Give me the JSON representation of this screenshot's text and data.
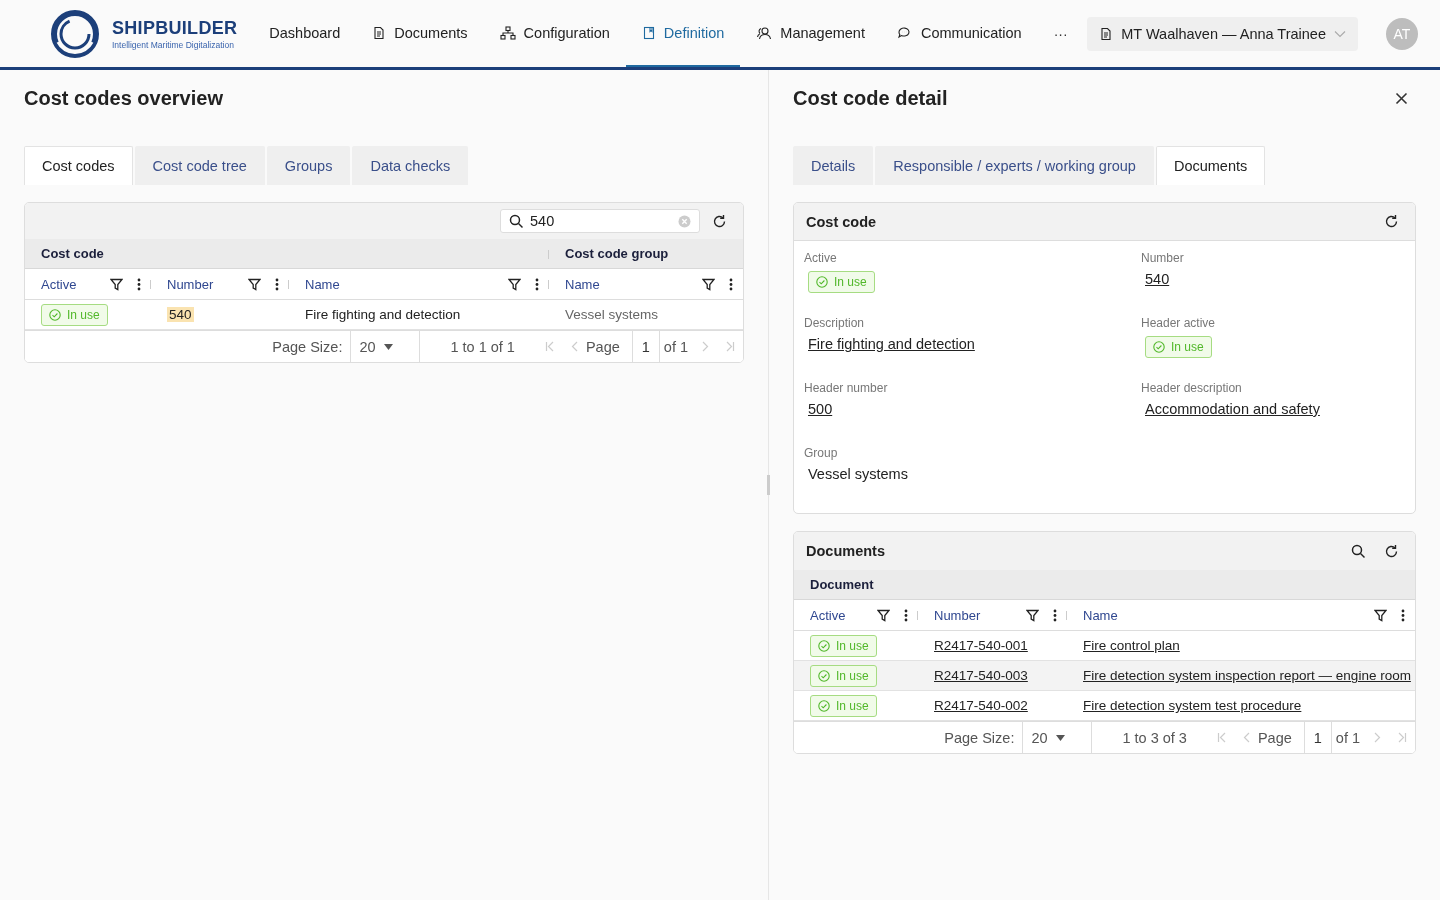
{
  "header": {
    "logo": {
      "name": "SHIPBUILDER",
      "tagline": "Intelligent Maritime Digitalization"
    },
    "nav": [
      {
        "label": "Dashboard",
        "selected": false
      },
      {
        "label": "Documents",
        "selected": false
      },
      {
        "label": "Configuration",
        "selected": false
      },
      {
        "label": "Definition",
        "selected": true
      },
      {
        "label": "Management",
        "selected": false
      },
      {
        "label": "Communication",
        "selected": false
      }
    ],
    "more": "···",
    "context": "MT Waalhaven — Anna Trainee",
    "avatar": "AT"
  },
  "overview": {
    "title": "Cost codes overview",
    "tabs": [
      {
        "label": "Cost codes",
        "selected": true
      },
      {
        "label": "Cost code tree",
        "selected": false
      },
      {
        "label": "Groups",
        "selected": false
      },
      {
        "label": "Data checks",
        "selected": false
      }
    ],
    "grid": {
      "search": "540",
      "column_groups": [
        {
          "label": "Cost code",
          "columns": [
            "Active",
            "Number",
            "Name"
          ]
        },
        {
          "label": "Cost code group",
          "columns": [
            "Name"
          ]
        }
      ],
      "rows": [
        {
          "selected": false,
          "cells": [
            {
              "kind": "status",
              "text": "In use",
              "active": true
            },
            {
              "kind": "text",
              "text": "540",
              "match": true
            },
            {
              "kind": "text",
              "text": "Fire fighting and detection",
              "match": false
            },
            {
              "kind": "muted",
              "text": "Vessel systems"
            }
          ]
        }
      ],
      "pagination": {
        "page_size_label": "Page Size:",
        "page_size": "20",
        "range": "1 to 1 of 1",
        "page_label": "Page",
        "page": "1",
        "of": "of 1"
      }
    }
  },
  "detail": {
    "title": "Cost code detail",
    "tabs": [
      {
        "label": "Details",
        "selected": false
      },
      {
        "label": "Responsible / experts / working group",
        "selected": false
      },
      {
        "label": "Documents",
        "selected": true
      }
    ],
    "card": {
      "title": "Cost code",
      "fields": [
        {
          "label": "Active",
          "kind": "status",
          "value": "In use",
          "active": true
        },
        {
          "label": "Number",
          "kind": "link",
          "value": "540"
        },
        {
          "label": "Description",
          "kind": "link",
          "value": "Fire fighting and detection"
        },
        {
          "label": "Header active",
          "kind": "status",
          "value": "In use",
          "active": true
        },
        {
          "label": "Header number",
          "kind": "link",
          "value": "500"
        },
        {
          "label": "Header description",
          "kind": "link",
          "value": "Accommodation and safety"
        },
        {
          "label": "Group",
          "kind": "text",
          "value": "Vessel systems"
        }
      ]
    },
    "documents": {
      "title": "Documents",
      "column_groups": [
        {
          "label": "Document",
          "columns": [
            "Active",
            "Number",
            "Name"
          ]
        }
      ],
      "rows": [
        {
          "selected": false,
          "cells": [
            {
              "kind": "status",
              "text": "In use",
              "active": true
            },
            {
              "kind": "link",
              "text": "R2417-540-001"
            },
            {
              "kind": "link",
              "text": "Fire control plan"
            }
          ]
        },
        {
          "selected": true,
          "cells": [
            {
              "kind": "status",
              "text": "In use",
              "active": true
            },
            {
              "kind": "link",
              "text": "R2417-540-003"
            },
            {
              "kind": "link",
              "text": "Fire detection system inspection report — engine room"
            }
          ]
        },
        {
          "selected": false,
          "cells": [
            {
              "kind": "status",
              "text": "In use",
              "active": true
            },
            {
              "kind": "link",
              "text": "R2417-540-002"
            },
            {
              "kind": "link",
              "text": "Fire detection system test procedure"
            }
          ]
        }
      ],
      "pagination": {
        "page_size_label": "Page Size:",
        "page_size": "20",
        "range": "1 to 3 of 3",
        "page_label": "Page",
        "page": "1",
        "of": "of 1"
      }
    }
  }
}
